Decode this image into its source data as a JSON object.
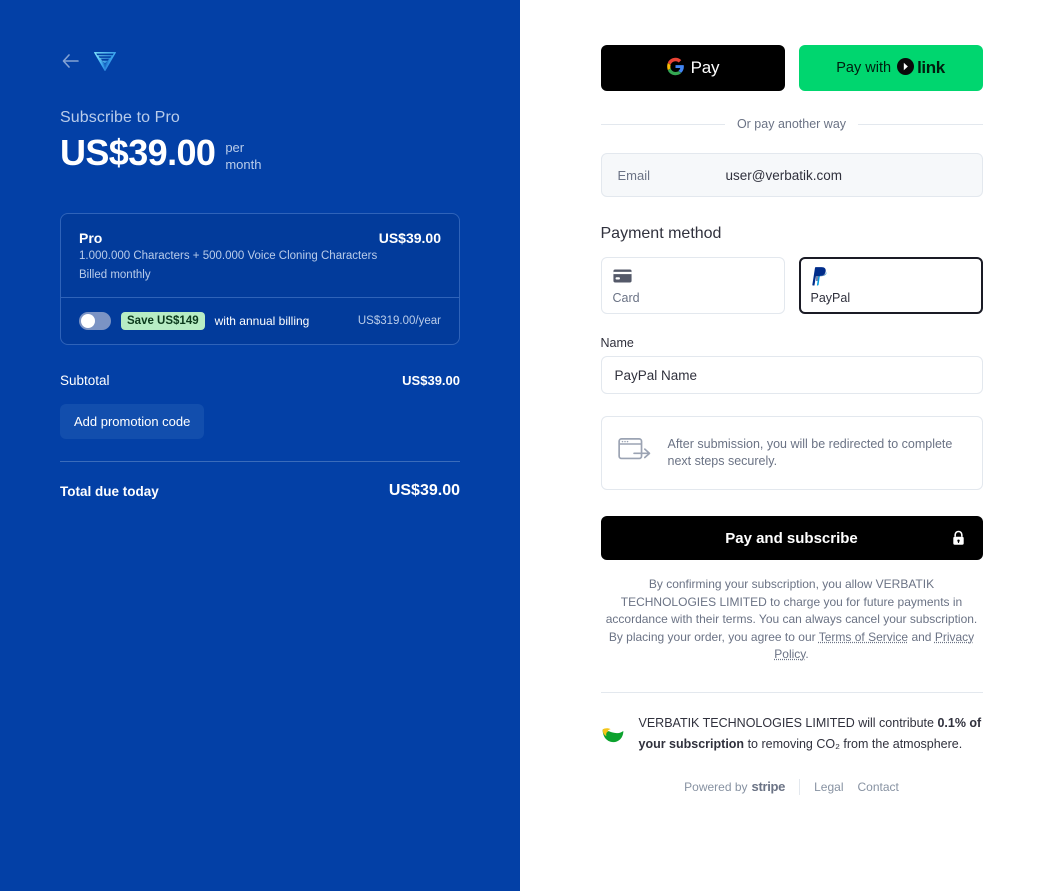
{
  "brand": {
    "logo_icon": "verbatik-triangle-logo",
    "back_icon": "back-arrow-icon",
    "accent_blue": "#0340a6"
  },
  "summary": {
    "subscribe_title": "Subscribe to Pro",
    "price_amount": "US$39.00",
    "price_period_line1": "per",
    "price_period_line2": "month",
    "product": {
      "name": "Pro",
      "price": "US$39.00",
      "description": "1.000.000 Characters + 500.000 Voice Cloning Characters",
      "billing": "Billed monthly"
    },
    "annual_toggle": {
      "state": "off",
      "save_badge": "Save US$149",
      "text": "with annual billing",
      "annual_price": "US$319.00/year"
    },
    "subtotal_label": "Subtotal",
    "subtotal_value": "US$39.00",
    "promo_button": "Add promotion code",
    "total_label": "Total due today",
    "total_value": "US$39.00"
  },
  "payment": {
    "wallets": {
      "gpay_label": "Pay",
      "gpay_icon": "google-g-icon",
      "link_prefix": "Pay with",
      "link_word": "link",
      "link_icon": "link-chevron-icon",
      "link_color": "#00d66f"
    },
    "or_divider": "Or pay another way",
    "email": {
      "label": "Email",
      "value": "user@verbatik.com"
    },
    "section_title": "Payment method",
    "methods": [
      {
        "id": "card",
        "label": "Card",
        "icon": "credit-card-icon",
        "selected": false
      },
      {
        "id": "paypal",
        "label": "PayPal",
        "icon": "paypal-icon",
        "selected": true
      }
    ],
    "name_field": {
      "label": "Name",
      "placeholder": "PayPal Name",
      "value": ""
    },
    "redirect_notice": {
      "icon": "redirect-window-icon",
      "text": "After submission, you will be redirected to complete next steps securely."
    },
    "submit_button": {
      "label": "Pay and subscribe",
      "icon": "lock-icon"
    },
    "legal": {
      "line1": "By confirming your subscription, you allow VERBATIK TECHNOLOGIES LIMITED to charge you for future payments in accordance with their terms. You can always cancel your subscription.",
      "line2_prefix": "By placing your order, you agree to our",
      "terms_link": "Terms of Service",
      "and_word": "and",
      "privacy_link": "Privacy Policy",
      "period": "."
    },
    "climate": {
      "icon": "stripe-climate-leaf-icon",
      "prefix": "VERBATIK TECHNOLOGIES LIMITED will contribute",
      "bold": "0.1% of your subscription",
      "suffix": "to removing CO₂ from the atmosphere."
    },
    "footer": {
      "powered_by": "Powered by",
      "stripe": "stripe",
      "legal_link": "Legal",
      "contact_link": "Contact"
    }
  }
}
